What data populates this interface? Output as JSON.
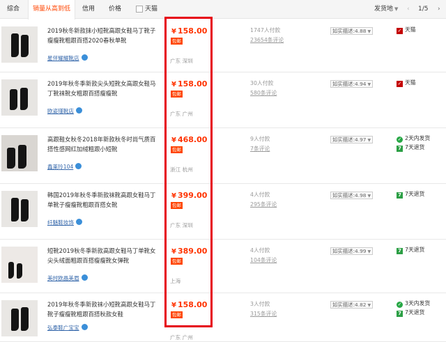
{
  "sortbar": {
    "tabs": [
      "综合",
      "销量从高到低",
      "信用",
      "价格"
    ],
    "active_tab": "销量从高到低",
    "tmall_filter": "天猫",
    "ship_from": "发货地",
    "pager": "1/5"
  },
  "products": [
    {
      "title": "2019秋冬新款抹小短靴高跟女鞋马丁靴子瘦瘦靴粗跟百搭2020春秋单靴",
      "shop": "星伴耀耀靴店",
      "price": "158.00",
      "free_shipping": "包邮",
      "location": "广东 深圳",
      "sales": "1747人付款",
      "reviews": "23654条评论",
      "rating": "如实描述:4.88",
      "services": [
        "天猫"
      ]
    },
    {
      "title": "2019年秋冬季新款尖头短靴女高跟女鞋马丁靴袜靴女粗跟百搭瘦瘦靴",
      "shop": "欧姿瑾靴店",
      "price": "158.00",
      "free_shipping": "包邮",
      "location": "广东 广州",
      "sales": "30人付款",
      "reviews": "580条评论",
      "rating": "如实描述:4.94",
      "services": [
        "天猫"
      ]
    },
    {
      "title": "高跟鞋女秋冬2018年新款秋冬时尚气质百搭性感网红加绒粗跟小短靴",
      "shop": "鑫莱玲104",
      "price": "468.00",
      "free_shipping": "包邮",
      "location": "浙江 杭州",
      "sales": "9人付款",
      "reviews": "7条评论",
      "rating": "如实描述:4.97",
      "services": [
        "2天内发货",
        "7天退货"
      ]
    },
    {
      "title": "韩国2019年秋冬季新款袜靴高跟女鞋马丁单靴子瘦瘦靴粗跟百搭女靴",
      "shop": "纤魅鞋妆饰",
      "price": "399.00",
      "free_shipping": "包邮",
      "location": "广东 深圳",
      "sales": "4人付款",
      "reviews": "295条评论",
      "rating": "如实描述:4.98",
      "services": [
        "7天退货"
      ]
    },
    {
      "title": "短靴2019秋冬季新款高跟女鞋马丁单靴女尖头绒面粗跟百搭瘦瘦靴女弹靴",
      "shop": "美时欧晶美眉",
      "price": "389.00",
      "free_shipping": "包邮",
      "location": "上海",
      "sales": "4人付款",
      "reviews": "104条评论",
      "rating": "如实描述:4.99",
      "services": [
        "7天退货"
      ]
    },
    {
      "title": "2019年秋冬季新款袜小短靴高跟女鞋马丁靴子瘦瘦靴粗跟百搭秋款女鞋",
      "shop": "弘泰鞋广宝宝",
      "price": "158.00",
      "free_shipping": "包邮",
      "location": "广东 广州",
      "sales": "3人付款",
      "reviews": "315条评论",
      "rating": "如实描述:4.82",
      "services": [
        "3天内发货",
        "7天退货"
      ]
    }
  ],
  "currency_symbol": "¥",
  "colors": {
    "price": "#ff3300",
    "highlight": "#e60012",
    "active_tab": "#ff4400",
    "tmall": "#c40000",
    "service_green": "#2c9f45"
  }
}
